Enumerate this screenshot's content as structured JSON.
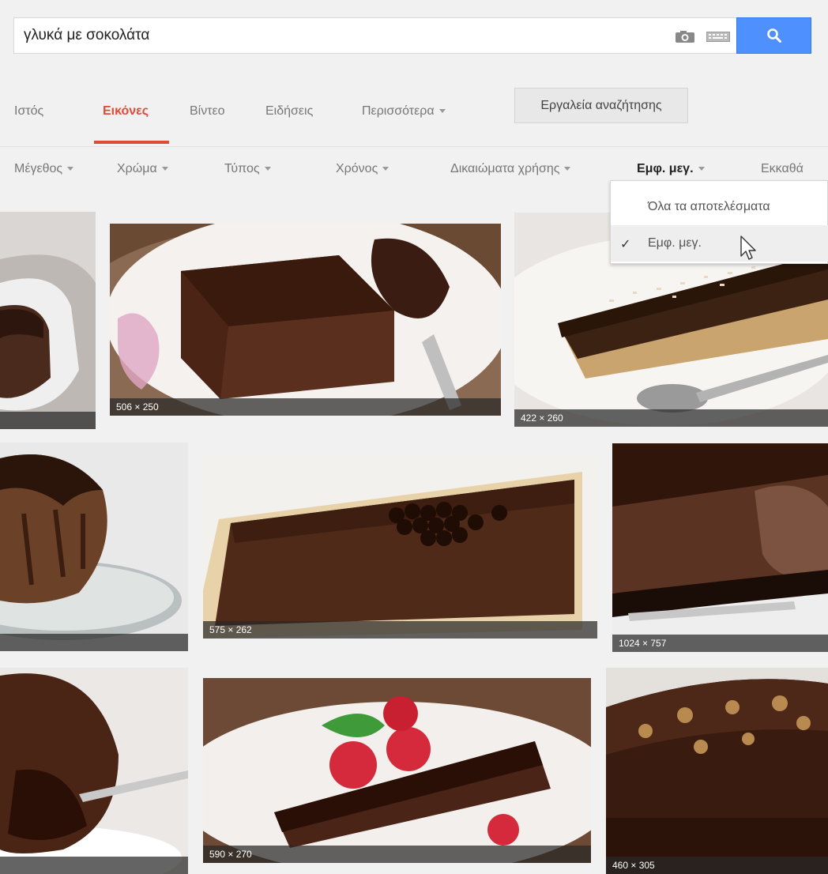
{
  "search": {
    "query": "γλυκά με σοκολάτα"
  },
  "tabs": [
    {
      "label": "Ιστός"
    },
    {
      "label": "Εικόνες"
    },
    {
      "label": "Βίντεο"
    },
    {
      "label": "Ειδήσεις"
    },
    {
      "label": "Περισσότερα"
    }
  ],
  "tools_label": "Εργαλεία αναζήτησης",
  "filters": [
    {
      "label": "Μέγεθος"
    },
    {
      "label": "Χρώμα"
    },
    {
      "label": "Τύπος"
    },
    {
      "label": "Χρόνος"
    },
    {
      "label": "Δικαιώματα χρήσης"
    },
    {
      "label": "Εμφ. μεγ."
    },
    {
      "label": "Εκκαθά"
    }
  ],
  "dropdown": {
    "items": [
      {
        "label": "Όλα τα αποτελέσματα"
      },
      {
        "label": "Εμφ. μεγ."
      }
    ]
  },
  "images": [
    {
      "size": ""
    },
    {
      "size": "506 × 250"
    },
    {
      "size": "422 × 260"
    },
    {
      "size": ""
    },
    {
      "size": "575 × 262"
    },
    {
      "size": "1024 × 757"
    },
    {
      "size": ""
    },
    {
      "size": "590 × 270"
    },
    {
      "size": "460 × 305"
    }
  ],
  "colors": {
    "accent": "#dd4b39",
    "search_button": "#4d90fe"
  }
}
